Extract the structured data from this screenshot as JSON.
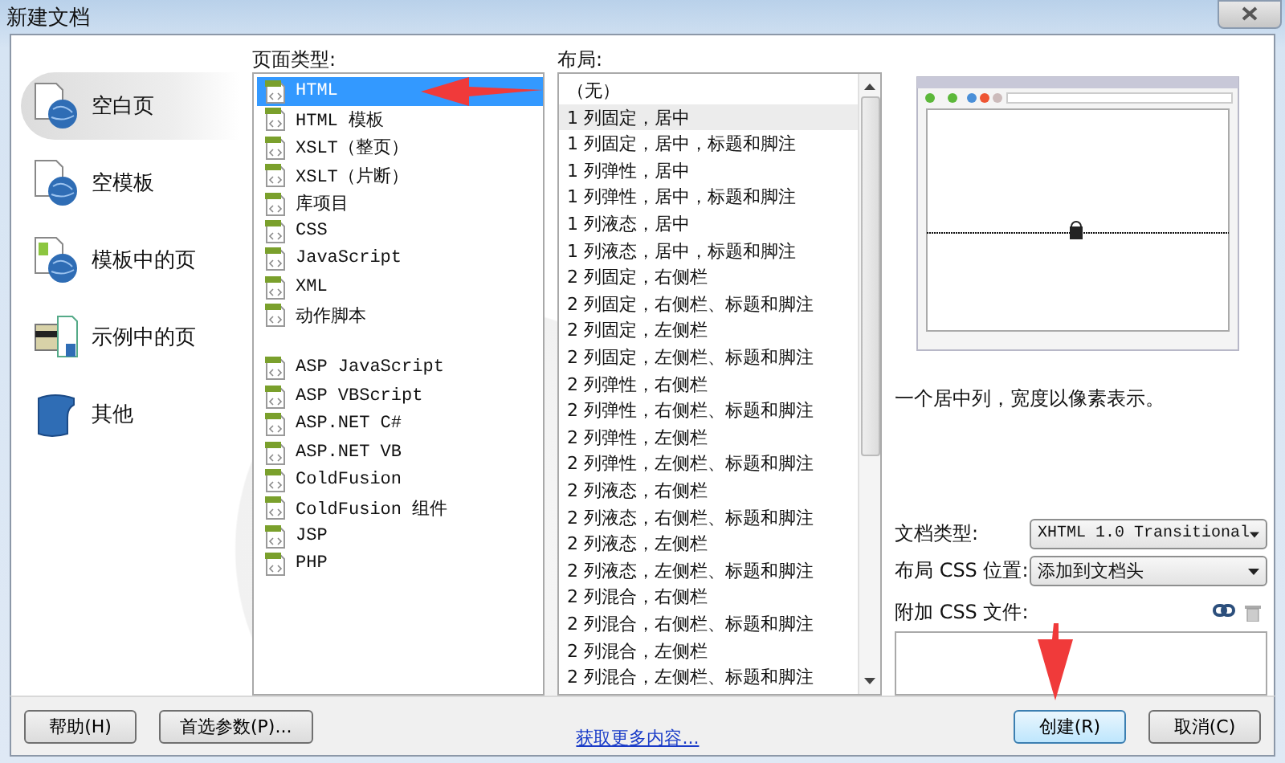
{
  "window": {
    "title": "新建文档"
  },
  "sidebar": {
    "items": [
      {
        "label": "空白页",
        "selected": true
      },
      {
        "label": "空模板",
        "selected": false
      },
      {
        "label": "模板中的页",
        "selected": false
      },
      {
        "label": "示例中的页",
        "selected": false
      },
      {
        "label": "其他",
        "selected": false
      }
    ]
  },
  "page_types": {
    "label": "页面类型:",
    "groups": [
      [
        {
          "label": "HTML",
          "selected": true
        },
        {
          "label": "HTML 模板",
          "selected": false
        },
        {
          "label": "XSLT（整页）",
          "selected": false
        },
        {
          "label": "XSLT（片断）",
          "selected": false
        },
        {
          "label": "库项目",
          "selected": false
        },
        {
          "label": "CSS",
          "selected": false
        },
        {
          "label": "JavaScript",
          "selected": false
        },
        {
          "label": "XML",
          "selected": false
        },
        {
          "label": "动作脚本",
          "selected": false
        }
      ],
      [
        {
          "label": "ASP JavaScript",
          "selected": false
        },
        {
          "label": "ASP VBScript",
          "selected": false
        },
        {
          "label": "ASP.NET C#",
          "selected": false
        },
        {
          "label": "ASP.NET VB",
          "selected": false
        },
        {
          "label": "ColdFusion",
          "selected": false
        },
        {
          "label": "ColdFusion 组件",
          "selected": false
        },
        {
          "label": "JSP",
          "selected": false
        },
        {
          "label": "PHP",
          "selected": false
        }
      ]
    ]
  },
  "layouts": {
    "label": "布局:",
    "items": [
      {
        "label": "（无）",
        "selected": false
      },
      {
        "label": "1 列固定，居中",
        "selected": true
      },
      {
        "label": "1 列固定，居中，标题和脚注",
        "selected": false
      },
      {
        "label": "1 列弹性，居中",
        "selected": false
      },
      {
        "label": "1 列弹性，居中，标题和脚注",
        "selected": false
      },
      {
        "label": "1 列液态，居中",
        "selected": false
      },
      {
        "label": "1 列液态，居中，标题和脚注",
        "selected": false
      },
      {
        "label": "2 列固定，右侧栏",
        "selected": false
      },
      {
        "label": "2 列固定，右侧栏、标题和脚注",
        "selected": false
      },
      {
        "label": "2 列固定，左侧栏",
        "selected": false
      },
      {
        "label": "2 列固定，左侧栏、标题和脚注",
        "selected": false
      },
      {
        "label": "2 列弹性，右侧栏",
        "selected": false
      },
      {
        "label": "2 列弹性，右侧栏、标题和脚注",
        "selected": false
      },
      {
        "label": "2 列弹性，左侧栏",
        "selected": false
      },
      {
        "label": "2 列弹性，左侧栏、标题和脚注",
        "selected": false
      },
      {
        "label": "2 列液态，右侧栏",
        "selected": false
      },
      {
        "label": "2 列液态，右侧栏、标题和脚注",
        "selected": false
      },
      {
        "label": "2 列液态，左侧栏",
        "selected": false
      },
      {
        "label": "2 列液态，左侧栏、标题和脚注",
        "selected": false
      },
      {
        "label": "2 列混合，右侧栏",
        "selected": false
      },
      {
        "label": "2 列混合，右侧栏、标题和脚注",
        "selected": false
      },
      {
        "label": "2 列混合，左侧栏",
        "selected": false
      },
      {
        "label": "2 列混合，左侧栏、标题和脚注",
        "selected": false
      }
    ]
  },
  "details": {
    "description": "一个居中列，宽度以像素表示。",
    "doc_type": {
      "label": "文档类型:",
      "value": "XHTML 1.0 Transitional"
    },
    "css_position": {
      "label": "布局 CSS 位置:",
      "value": "添加到文档头"
    },
    "attach_css": {
      "label": "附加 CSS 文件:"
    }
  },
  "footer": {
    "help": "帮助(H)",
    "preferences": "首选参数(P)...",
    "more_link": "获取更多内容...",
    "create": "创建(R)",
    "cancel": "取消(C)"
  }
}
